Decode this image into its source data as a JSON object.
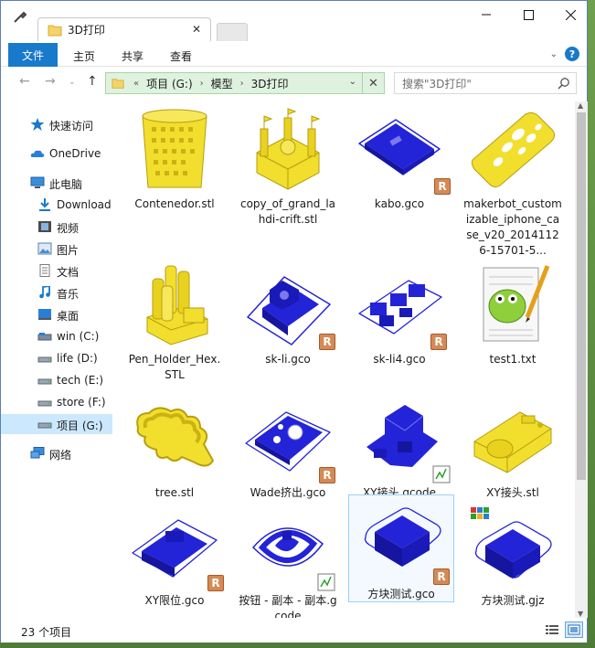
{
  "window": {
    "tab_title": "3D打印",
    "controls": {
      "minimize": "minimize",
      "maximize": "maximize",
      "close": "close"
    }
  },
  "ribbon": {
    "tabs": [
      {
        "label": "文件",
        "active": true
      },
      {
        "label": "主页"
      },
      {
        "label": "共享"
      },
      {
        "label": "查看"
      }
    ],
    "help_label": "?"
  },
  "address": {
    "overflow": "«",
    "crumbs": [
      "项目 (G:)",
      "模型",
      "3D打印"
    ],
    "separator": "›",
    "search_placeholder": "搜索\"3D打印\""
  },
  "sidebar": {
    "items": [
      {
        "label": "快速访问",
        "icon": "star-icon"
      },
      {
        "label": "OneDrive",
        "icon": "onedrive-icon"
      },
      {
        "label": "此电脑",
        "icon": "pc-icon"
      },
      {
        "label": "Download",
        "icon": "download-icon"
      },
      {
        "label": "视频",
        "icon": "video-icon"
      },
      {
        "label": "图片",
        "icon": "pictures-icon"
      },
      {
        "label": "文档",
        "icon": "documents-icon"
      },
      {
        "label": "音乐",
        "icon": "music-icon"
      },
      {
        "label": "桌面",
        "icon": "desktop-icon"
      },
      {
        "label": "win (C:)",
        "icon": "drive-icon"
      },
      {
        "label": "life (D:)",
        "icon": "drive-icon"
      },
      {
        "label": "tech (E:)",
        "icon": "drive-icon"
      },
      {
        "label": "store (F:)",
        "icon": "drive-icon"
      },
      {
        "label": "项目 (G:)",
        "icon": "drive-icon",
        "selected": true
      },
      {
        "label": "网络",
        "icon": "network-icon"
      }
    ]
  },
  "files": [
    {
      "name": "Contenedor.stl",
      "kind": "stl-basket"
    },
    {
      "name": "copy_of_grand_lahdi-crift.stl",
      "kind": "stl-castle"
    },
    {
      "name": "kabo.gco",
      "kind": "gco-plate"
    },
    {
      "name": "makerbot_customizable_iphone_case_v20_20141126-15701-5...",
      "kind": "stl-case"
    },
    {
      "name": "Pen_Holder_Hex.STL",
      "kind": "stl-pen"
    },
    {
      "name": "sk-li.gco",
      "kind": "gco-bracket"
    },
    {
      "name": "sk-li4.gco",
      "kind": "gco-parts"
    },
    {
      "name": "test1.txt",
      "kind": "txt-notepad"
    },
    {
      "name": "tree.stl",
      "kind": "stl-tree"
    },
    {
      "name": "Wade挤出.gco",
      "kind": "gco-wade"
    },
    {
      "name": "XY接头.gcode",
      "kind": "gcode-xy"
    },
    {
      "name": "XY接头.stl",
      "kind": "stl-xy"
    },
    {
      "name": "XY限位.gco",
      "kind": "gco-xylimit"
    },
    {
      "name": "按钮 - 副本 - 副本.gcode",
      "kind": "gcode-button"
    },
    {
      "name": "方块测试.gco",
      "kind": "gco-cube",
      "focused": true
    },
    {
      "name": "方块测试.gjz",
      "kind": "gjz-cube"
    }
  ],
  "status": {
    "item_count": "23 个项目"
  },
  "colors": {
    "accent": "#1979ca",
    "stl": "#f2de2c",
    "gcode": "#2323d8",
    "address_bg": "#dff2df",
    "selected": "#cce8ff"
  }
}
